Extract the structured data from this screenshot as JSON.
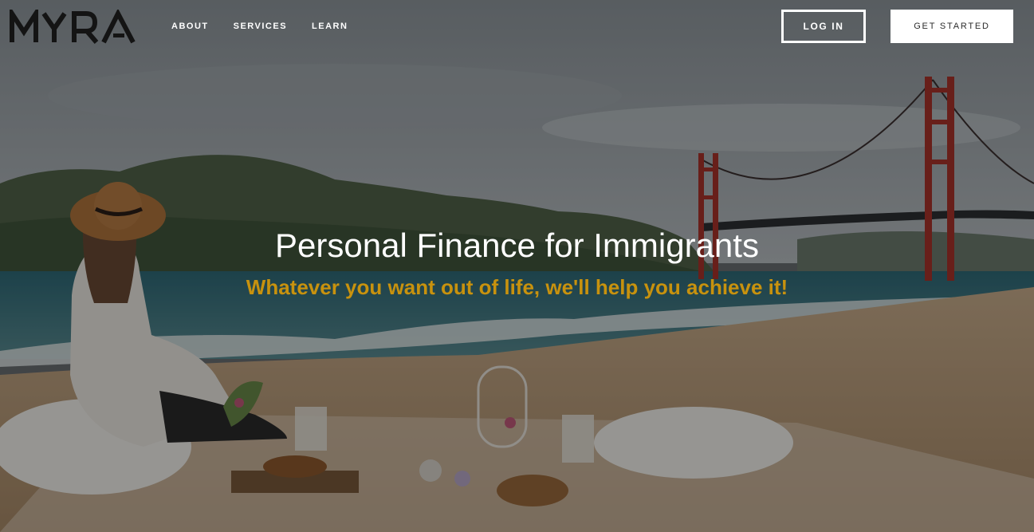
{
  "brand": {
    "logo_text": "MYRA"
  },
  "nav": {
    "links": [
      {
        "label": "ABOUT"
      },
      {
        "label": "SERVICES"
      },
      {
        "label": "LEARN"
      }
    ],
    "login_label": "LOG IN",
    "get_started_label": "GET STARTED"
  },
  "hero": {
    "headline": "Personal Finance for Immigrants",
    "subheadline": "Whatever you want out of life, we'll help you achieve it!",
    "background": "photo-beach-picnic-golden-gate-bridge"
  },
  "colors": {
    "subheadline": "#c8920e",
    "text_light": "#ffffff",
    "bridge": "#a8322a"
  }
}
